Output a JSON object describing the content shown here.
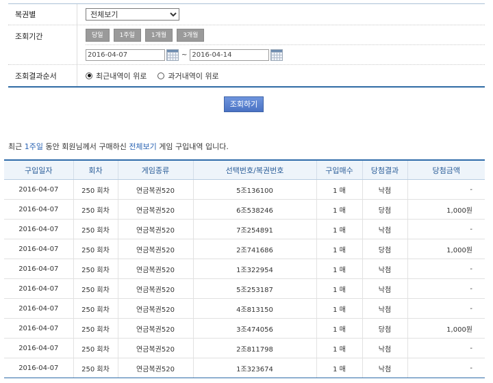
{
  "form": {
    "lottery_label": "복권별",
    "lottery_select": "전체보기",
    "period_label": "조회기간",
    "period_buttons": [
      "당일",
      "1주일",
      "1개월",
      "3개월"
    ],
    "date_from": "2016-04-07",
    "date_sep": "~",
    "date_to": "2016-04-14",
    "order_label": "조회결과순서",
    "order_recent": "최근내역이 위로",
    "order_past": "과거내역이 위로",
    "order_selected": "recent"
  },
  "search_button": "조회하기",
  "summary": {
    "pre": "최근 ",
    "period": "1주일",
    "mid": " 동안 회원님께서 구매하신 ",
    "game": "전체보기",
    "post": " 게임 구입내역 입니다."
  },
  "table": {
    "headers": [
      "구입일자",
      "회차",
      "게임종류",
      "선택번호/복권번호",
      "구입매수",
      "당첨결과",
      "당첨금액"
    ],
    "rows": [
      [
        "2016-04-07",
        "250 회차",
        "연금복권520",
        "5조136100",
        "1 매",
        "낙첨",
        "-"
      ],
      [
        "2016-04-07",
        "250 회차",
        "연금복권520",
        "6조538246",
        "1 매",
        "당첨",
        "1,000원"
      ],
      [
        "2016-04-07",
        "250 회차",
        "연금복권520",
        "7조254891",
        "1 매",
        "낙첨",
        "-"
      ],
      [
        "2016-04-07",
        "250 회차",
        "연금복권520",
        "2조741686",
        "1 매",
        "당첨",
        "1,000원"
      ],
      [
        "2016-04-07",
        "250 회차",
        "연금복권520",
        "1조322954",
        "1 매",
        "낙첨",
        "-"
      ],
      [
        "2016-04-07",
        "250 회차",
        "연금복권520",
        "5조253187",
        "1 매",
        "낙첨",
        "-"
      ],
      [
        "2016-04-07",
        "250 회차",
        "연금복권520",
        "4조813150",
        "1 매",
        "낙첨",
        "-"
      ],
      [
        "2016-04-07",
        "250 회차",
        "연금복권520",
        "3조474056",
        "1 매",
        "당첨",
        "1,000원"
      ],
      [
        "2016-04-07",
        "250 회차",
        "연금복권520",
        "2조811798",
        "1 매",
        "낙첨",
        "-"
      ],
      [
        "2016-04-07",
        "250 회차",
        "연금복권520",
        "1조323674",
        "1 매",
        "낙첨",
        "-"
      ]
    ]
  },
  "colors": {
    "accent": "#2d6aa8",
    "header_bg": "#eef4fa",
    "button": "#4a72c4"
  }
}
